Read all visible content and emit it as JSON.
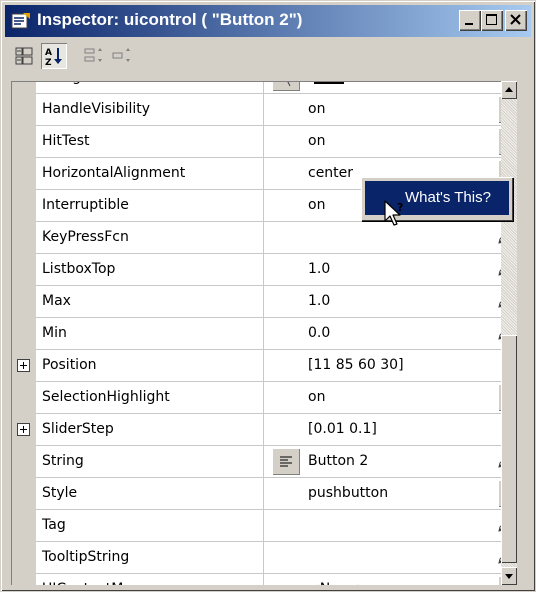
{
  "window": {
    "title": "Inspector: uicontrol ( \"Button 2\")",
    "icon": "inspector-icon",
    "controls": [
      "minimize-icon",
      "maximize-icon",
      "close-icon"
    ]
  },
  "toolbar": {
    "buttons": [
      {
        "name": "categorized-view-icon",
        "pressed": false
      },
      {
        "name": "sort-alphabetical-icon",
        "pressed": true
      },
      {
        "name": "expand-all-icon",
        "pressed": false
      },
      {
        "name": "collapse-all-icon",
        "pressed": false
      }
    ]
  },
  "properties": [
    {
      "name": "ForegroundColor",
      "value": "",
      "control": "color"
    },
    {
      "name": "HandleVisibility",
      "value": "on",
      "control": "dropdown"
    },
    {
      "name": "HitTest",
      "value": "on",
      "control": "dropdown"
    },
    {
      "name": "HorizontalAlignment",
      "value": "center",
      "control": "dropdown"
    },
    {
      "name": "Interruptible",
      "value": "on",
      "control": "dropdown"
    },
    {
      "name": "KeyPressFcn",
      "value": "",
      "control": "edit"
    },
    {
      "name": "ListboxTop",
      "value": "1.0",
      "control": "edit"
    },
    {
      "name": "Max",
      "value": "1.0",
      "control": "edit"
    },
    {
      "name": "Min",
      "value": "0.0",
      "control": "edit"
    },
    {
      "name": "Position",
      "value": "[11 85 60 30]",
      "control": "expand"
    },
    {
      "name": "SelectionHighlight",
      "value": "on",
      "control": "dropdown"
    },
    {
      "name": "SliderStep",
      "value": "[0.01 0.1]",
      "control": "expand"
    },
    {
      "name": "String",
      "value": "Button 2",
      "control": "text-edit"
    },
    {
      "name": "Style",
      "value": "pushbutton",
      "control": "dropdown"
    },
    {
      "name": "Tag",
      "value": "",
      "control": "edit"
    },
    {
      "name": "TooltipString",
      "value": "",
      "control": "edit"
    },
    {
      "name": "UIContextMenu",
      "value": "<None>",
      "control": "dropdown"
    }
  ],
  "context_menu": {
    "item": "What's This?"
  },
  "colors": {
    "title_start": "#0a246a",
    "title_end": "#a6caf0",
    "highlight": "#0a246a",
    "face": "#d4d0c8",
    "foreground_swatch": "#000000"
  }
}
